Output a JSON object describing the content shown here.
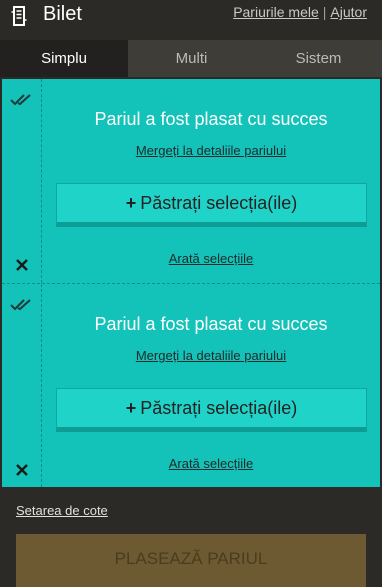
{
  "header": {
    "title": "Bilet",
    "my_bets_link": "Pariurile mele",
    "separator": "|",
    "help_link": "Ajutor",
    "icon": "ticket-icon"
  },
  "tabs": [
    {
      "label": "Simplu",
      "active": true
    },
    {
      "label": "Multi",
      "active": false
    },
    {
      "label": "Sistem",
      "active": false
    }
  ],
  "bets": [
    {
      "message": "Pariul a fost plasat cu succes",
      "details_link": "Mergeți la detaliile pariului",
      "keep_button_plus": "+",
      "keep_button_label": "Păstrați selecția(ile)",
      "show_selections_link": "Arată selecțiile"
    },
    {
      "message": "Pariul a fost plasat cu succes",
      "details_link": "Mergeți la detaliile pariului",
      "keep_button_plus": "+",
      "keep_button_label": "Păstrați selecția(ile)",
      "show_selections_link": "Arată selecțiile"
    }
  ],
  "footer": {
    "odds_setting_link": "Setarea de cote",
    "place_bet_button": "PLASEAZĂ PARIUL"
  },
  "colors": {
    "background": "#2b2a27",
    "success_panel": "#13c2b8",
    "place_button": "#6d5a32"
  }
}
